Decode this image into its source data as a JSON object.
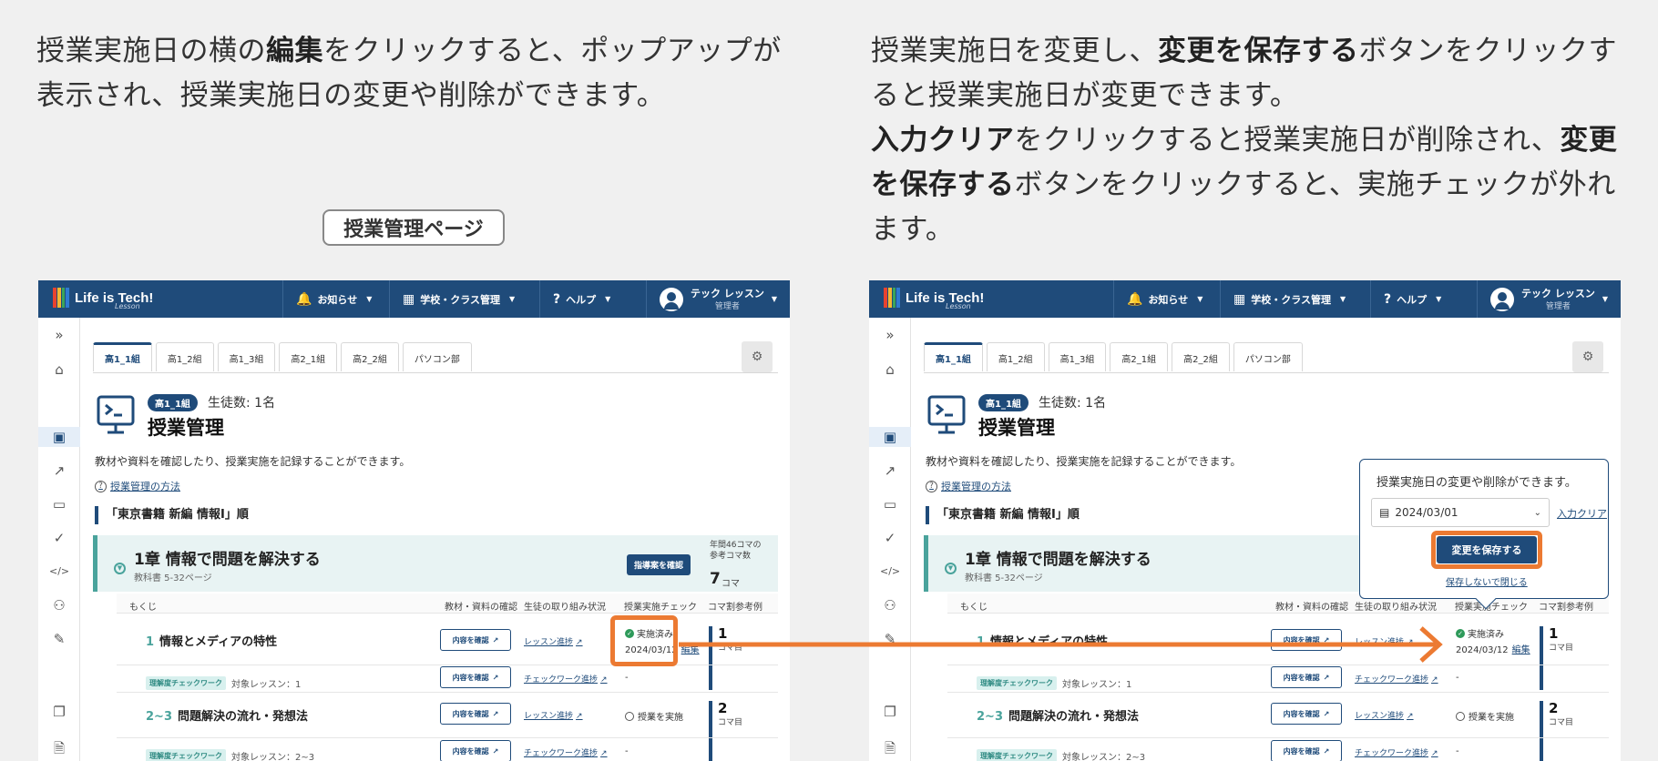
{
  "captions": {
    "left": {
      "p1": "授業実施日の横の",
      "b1": "編集",
      "p2": "をクリックすると、ポップアップが表示され、授業実施日の変更や削除ができます。"
    },
    "right": {
      "p1": "授業実施日を変更し、",
      "b1": "変更を保存する",
      "p2": "ボタンをクリックすると授業実施日が変更できます。",
      "b2": "入力クリア",
      "p3": "をクリックすると授業実施日が削除され、",
      "b3": "変更を保存する",
      "p4": "ボタンをクリックすると、実施チェックが外れます。"
    }
  },
  "page_tag": "授業管理ページ",
  "app": {
    "logo": "Life is Tech!",
    "logo_sub": "Lesson",
    "nav": {
      "news": "お知らせ",
      "school": "学校・クラス管理",
      "help": "ヘルプ"
    },
    "user": {
      "name": "テック レッスン",
      "role": "管理者"
    }
  },
  "tabs": [
    "高1_1組",
    "高1_2組",
    "高1_3組",
    "高2_1組",
    "高2_2組",
    "パソコン部"
  ],
  "header": {
    "class_badge": "高1_1組",
    "students": "生徒数: 1名",
    "title": "授業管理",
    "description": "教材や資料を確認したり、授業実施を記録することができます。",
    "howto": "授業管理の方法",
    "textbook": "「東京書籍 新編 情報Ⅰ」順"
  },
  "chapter": {
    "title": "1章 情報で問題を解決する",
    "subtitle": "教科書 5-32ページ",
    "guide_button": "指導案を確認",
    "yearly_l1": "年間46コマの",
    "yearly_l2": "参考コマ数",
    "koma_num": "7",
    "koma_unit": "コマ"
  },
  "table_headers": {
    "toc": "もくじ",
    "materials": "教材・資料の確認",
    "progress": "生徒の取り組み状況",
    "check": "授業実施チェック",
    "koma": "コマ割参考例"
  },
  "rows": [
    {
      "num": "1",
      "title": "情報とメディアの特性",
      "button": "内容を確認",
      "link": "レッスン進捗",
      "status": "実施済み",
      "date": "2024/03/12",
      "edit": "編集",
      "koma": "1",
      "koma_unit": "コマ目"
    },
    {
      "tag": "理解度チェックワーク",
      "target": "対象レッスン：1",
      "button": "内容を確認",
      "link": "チェックワーク進捗",
      "status": "-"
    },
    {
      "num": "2~3",
      "title": "問題解決の流れ・発想法",
      "button": "内容を確認",
      "link": "レッスン進捗",
      "status": "授業を実施",
      "koma": "2",
      "koma_unit": "コマ目"
    },
    {
      "tag": "理解度チェックワーク",
      "target": "対象レッスン：2~3",
      "button": "内容を確認",
      "link": "チェックワーク進捗",
      "status": "-"
    }
  ],
  "popover": {
    "message": "授業実施日の変更や削除ができます。",
    "date_value": "2024/03/01",
    "clear": "入力クリア",
    "save": "変更を保存する",
    "close": "保存しないで閉じる"
  },
  "colors": {
    "navy": "#1f4b7a",
    "highlight": "#ec7a32",
    "teal": "#4aa39c"
  }
}
